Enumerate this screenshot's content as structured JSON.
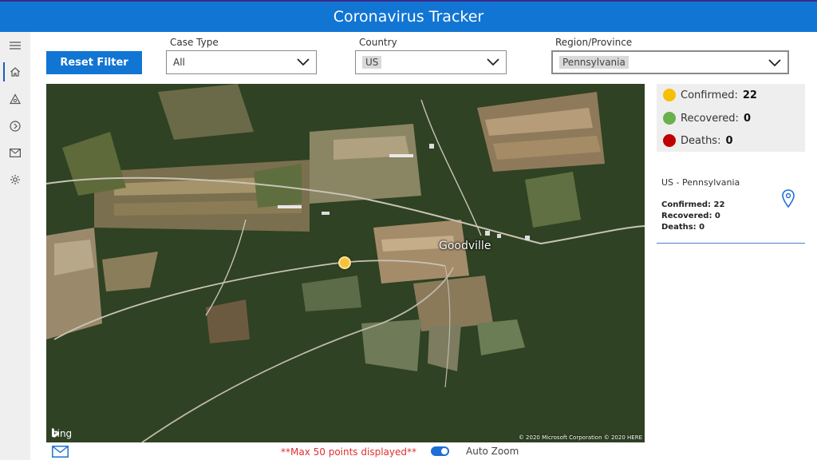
{
  "header": {
    "title": "Coronavirus Tracker"
  },
  "left_rail": {
    "items": [
      {
        "icon": "hamburger-menu-icon"
      },
      {
        "icon": "home-icon",
        "active": true
      },
      {
        "icon": "hazard-icon"
      },
      {
        "icon": "arrow-circle-icon"
      },
      {
        "icon": "mail-icon"
      },
      {
        "icon": "gear-icon"
      }
    ]
  },
  "filters": {
    "reset_label": "Reset Filter",
    "case_type": {
      "label": "Case Type",
      "value": "All"
    },
    "country": {
      "label": "Country",
      "value": "US"
    },
    "region": {
      "label": "Region/Province",
      "value": "Pennsylvania"
    }
  },
  "map": {
    "place_label": "Goodville",
    "provider": "bing",
    "copyright": "© 2020 Microsoft Corporation © 2020 HERE",
    "marker_color": "#f5c23a"
  },
  "stats": {
    "confirmed": {
      "label": "Confirmed:",
      "value": "22",
      "color": "#f5c000"
    },
    "recovered": {
      "label": "Recovered:",
      "value": "0",
      "color": "#6ab04c"
    },
    "deaths": {
      "label": "Deaths:",
      "value": "0",
      "color": "#c00000"
    }
  },
  "region_card": {
    "title": "US - Pennsylvania",
    "confirmed": "Confirmed: 22",
    "recovered": "Recovered: 0",
    "deaths": "Deaths: 0"
  },
  "footer": {
    "note": "**Max 50 points displayed**",
    "auto_zoom_label": "Auto Zoom",
    "auto_zoom_on": true
  },
  "colors": {
    "accent": "#1175d3",
    "note": "#e03030"
  }
}
